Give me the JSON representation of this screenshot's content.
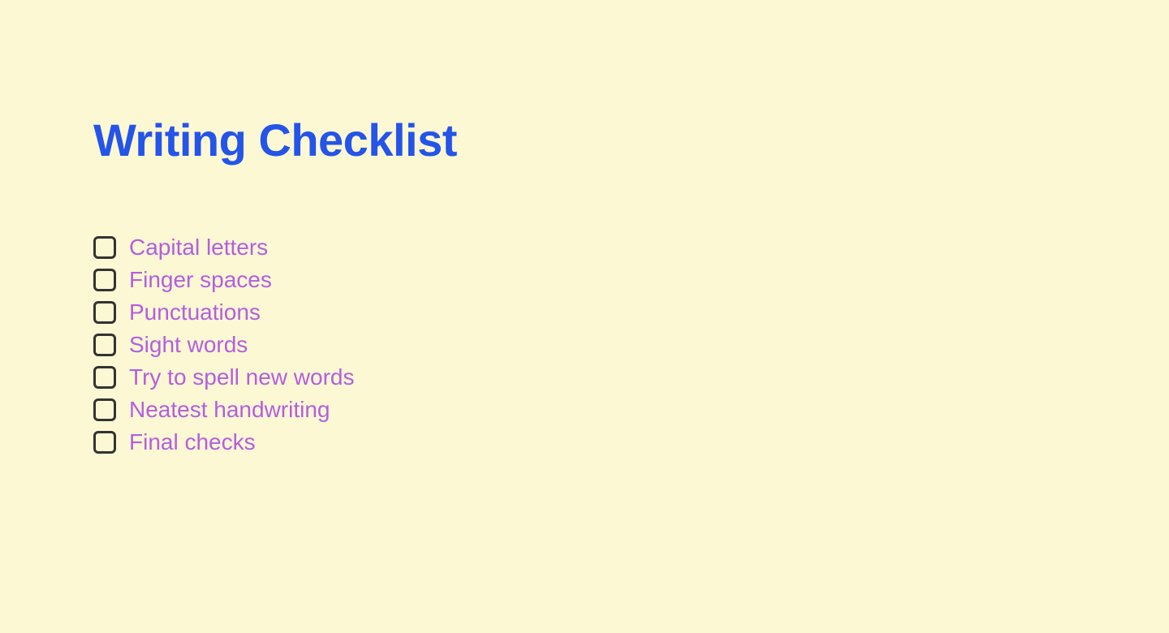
{
  "title": "Writing Checklist",
  "items": [
    {
      "label": "Capital letters"
    },
    {
      "label": "Finger spaces"
    },
    {
      "label": "Punctuations"
    },
    {
      "label": "Sight words"
    },
    {
      "label": "Try to spell new words"
    },
    {
      "label": "Neatest handwriting"
    },
    {
      "label": "Final checks"
    }
  ]
}
